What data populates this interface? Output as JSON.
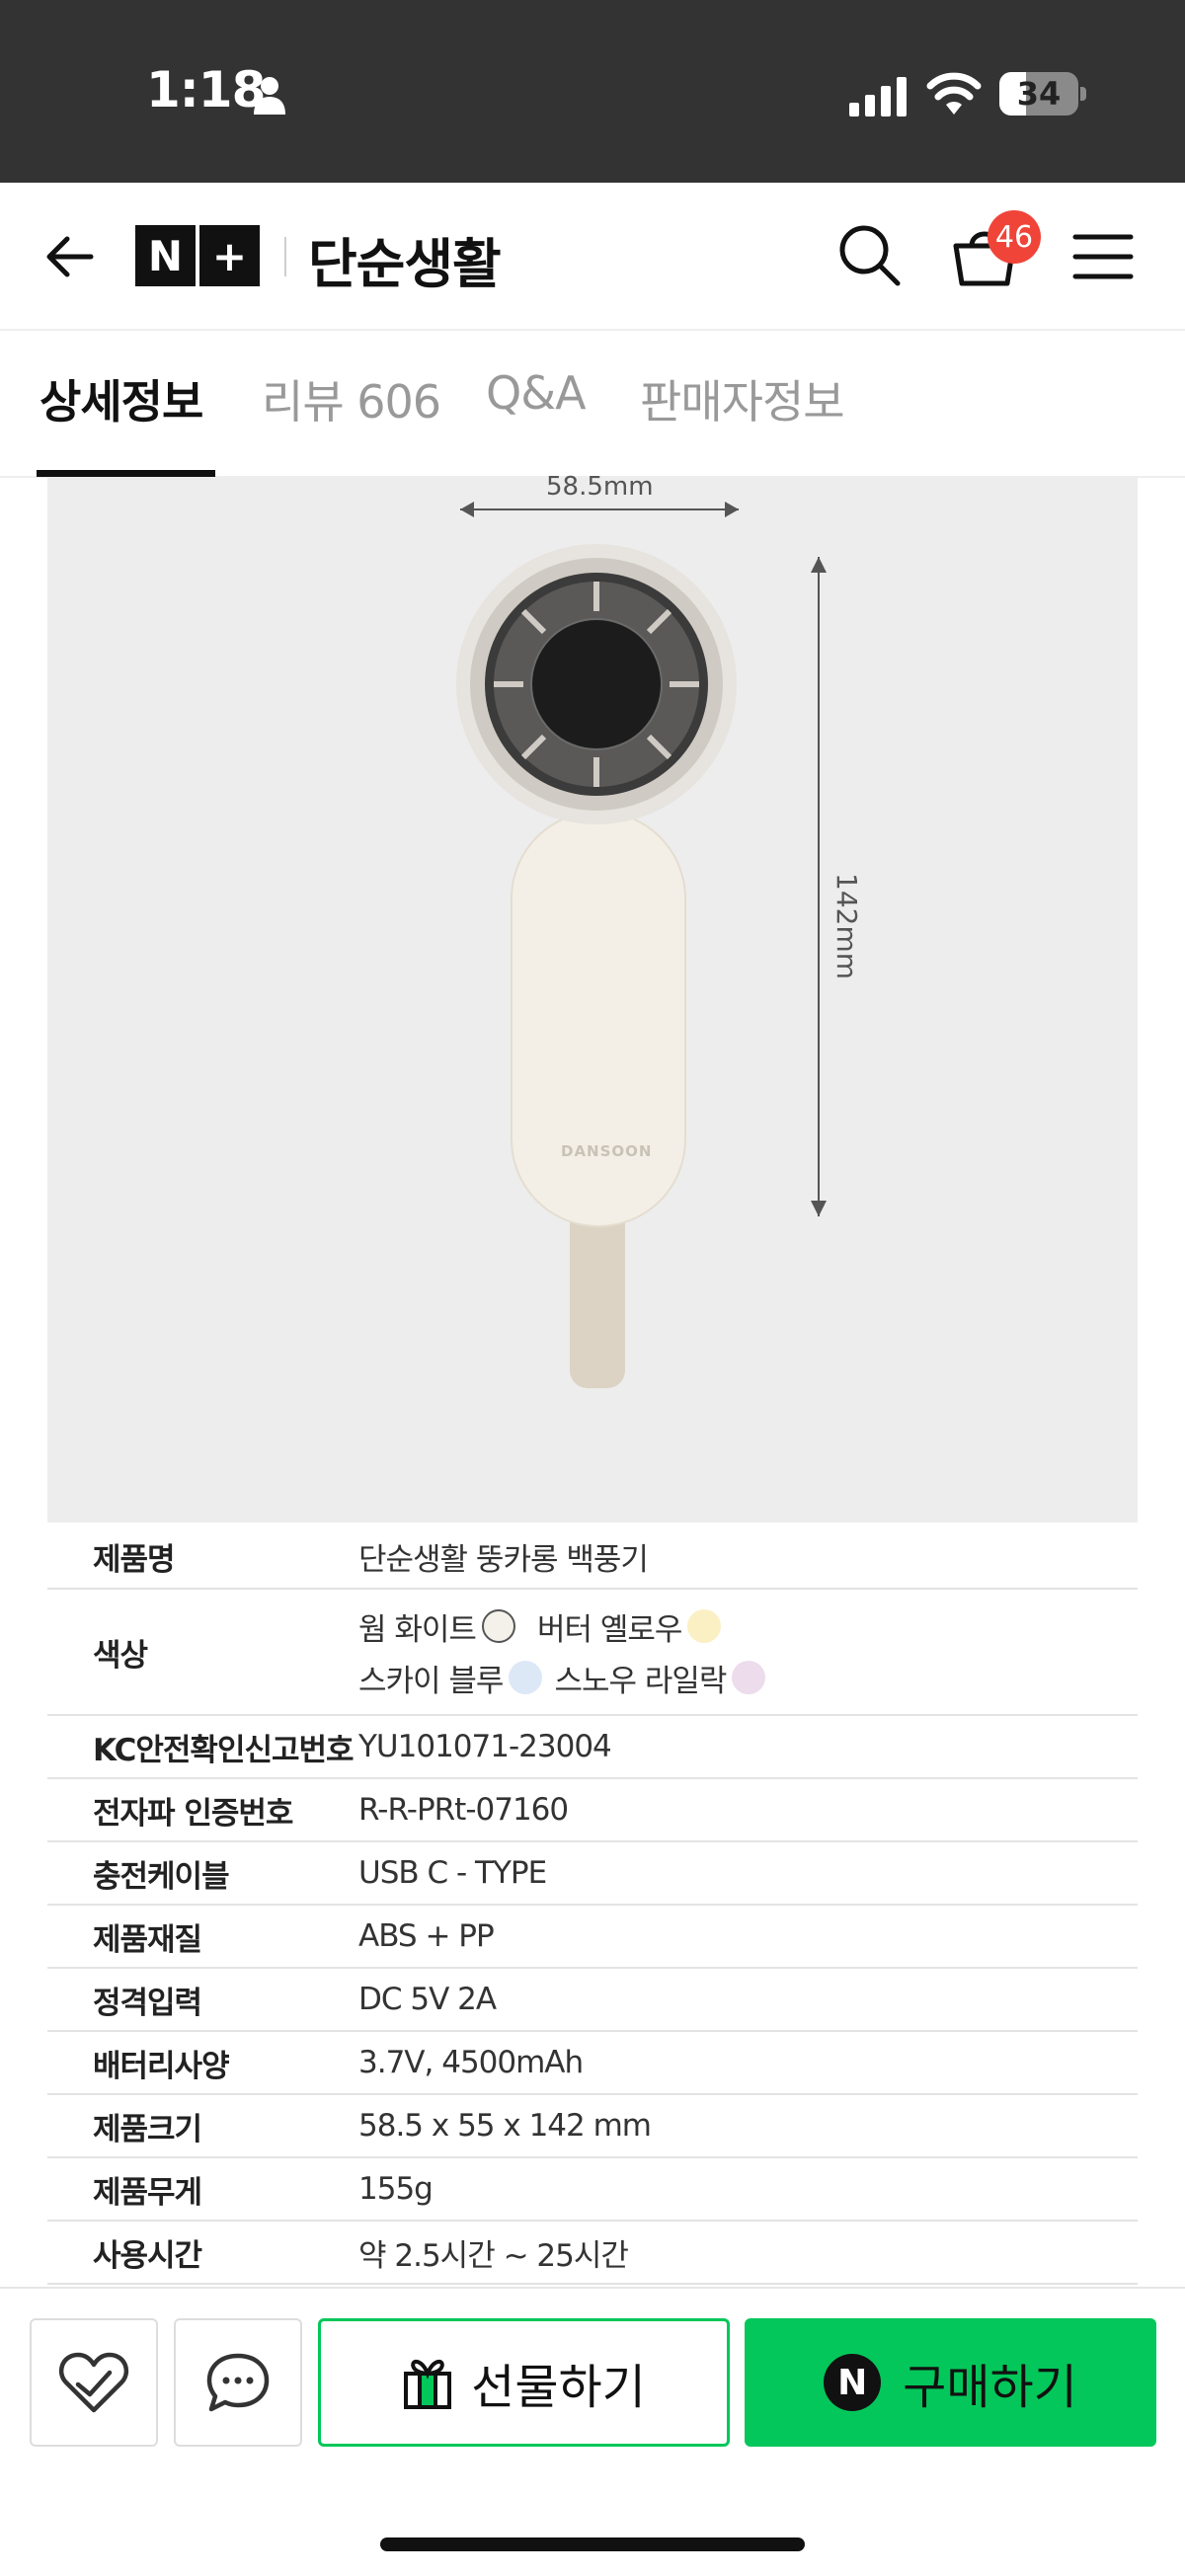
{
  "status_bar": {
    "time": "1:18",
    "battery_level": 34,
    "battery_label": "34",
    "person_icon": "person-icon",
    "signal_icon": "cellular-signal-icon",
    "wifi_icon": "wifi-icon"
  },
  "header": {
    "back_icon": "arrow-left-icon",
    "logo_left": "N",
    "logo_right": "+",
    "store_name": "단순생활",
    "search_icon": "search-icon",
    "cart_icon": "shopping-bag-icon",
    "cart_count": "46",
    "menu_icon": "hamburger-menu-icon"
  },
  "tabs": [
    {
      "label": "상세정보",
      "active": true
    },
    {
      "label": "리뷰 606",
      "active": false
    },
    {
      "label": "Q&A",
      "active": false
    },
    {
      "label": "판매자정보",
      "active": false
    }
  ],
  "product_image": {
    "width_label": "58.5mm",
    "height_label": "142mm",
    "brand_mark": "DANSOON"
  },
  "specs": [
    {
      "label": "제품명",
      "value": "단순생활 뚱카롱 백풍기"
    },
    {
      "label": "색상",
      "colors": [
        {
          "name": "웜 화이트",
          "color": "#f4f1ea"
        },
        {
          "name": "버터 옐로우",
          "color": "#fbf0c4"
        },
        {
          "name": "스카이 블루",
          "color": "#dde8f6"
        },
        {
          "name": "스노우 라일락",
          "color": "#ecdcec"
        }
      ]
    },
    {
      "label": "KC안전확인신고번호",
      "value": "YU101071-23004"
    },
    {
      "label": "전자파 인증번호",
      "value": "R-R-PRt-07160"
    },
    {
      "label": "충전케이블",
      "value": "USB C - TYPE"
    },
    {
      "label": "제품재질",
      "value": "ABS + PP"
    },
    {
      "label": "정격입력",
      "value": "DC 5V 2A"
    },
    {
      "label": "배터리사양",
      "value": "3.7V, 4500mAh"
    },
    {
      "label": "제품크기",
      "value": "58.5 x 55 x 142 mm"
    },
    {
      "label": "제품무게",
      "value": "155g"
    },
    {
      "label": "사용시간",
      "value": "약 2.5시간 ~ 25시간"
    }
  ],
  "bottom_bar": {
    "wishlist_icon": "heart-check-icon",
    "chat_icon": "chat-bubble-icon",
    "gift_icon": "gift-icon",
    "gift_label": "선물하기",
    "buy_icon": "npay-icon",
    "buy_mark": "N",
    "buy_label": "구매하기",
    "accent_color": "#03c75a"
  }
}
